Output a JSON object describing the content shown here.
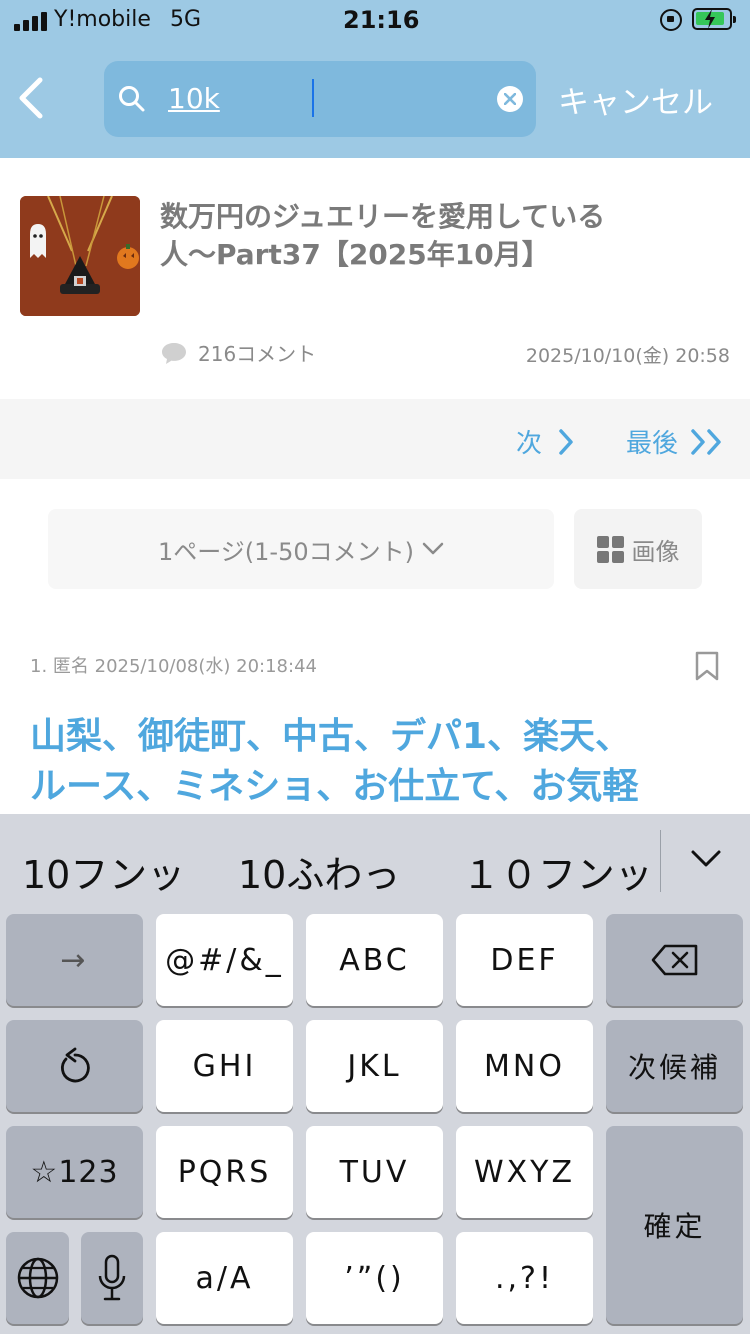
{
  "status_bar": {
    "carrier": "Y!mobile",
    "network": "5G",
    "time": "21:16"
  },
  "header": {
    "search_value": "10k",
    "cancel_label": "キャンセル"
  },
  "thread": {
    "title_line1": "数万円のジュエリーを愛用している",
    "title_line2": "人〜Part37【2025年10月】",
    "comment_count": "216コメント",
    "date": "2025/10/10(金) 20:58"
  },
  "pager": {
    "next_label": "次",
    "last_label": "最後"
  },
  "page_select": {
    "label": "1ページ(1-50コメント)",
    "image_button_label": "画像"
  },
  "comment": {
    "meta": "1. 匿名 2025/10/08(水) 20:18:44",
    "body_line1": "山梨、御徒町、中古、デパ1、楽天、",
    "body_line2": "ルース、ミネショ、お仕立て、お気軽"
  },
  "keyboard": {
    "suggestions": [
      "10フンッ",
      "10ふわっ",
      "１０フンッ"
    ],
    "keys": {
      "arrow": "→",
      "symbols": "@#/&_",
      "abc": "ABC",
      "def": "DEF",
      "ghi": "GHI",
      "jkl": "JKL",
      "mno": "MNO",
      "next_candidate": "次候補",
      "num": "☆123",
      "pqrs": "PQRS",
      "tuv": "TUV",
      "wxyz": "WXYZ",
      "confirm": "確定",
      "case": "a/A",
      "quotes": "’”()",
      "punct": ".,?!"
    }
  },
  "colors": {
    "header_bg": "#9dc9e4",
    "search_bg": "#7fb9dd",
    "accent_blue": "#4fa7de",
    "keyboard_bg": "#d3d6dd"
  }
}
